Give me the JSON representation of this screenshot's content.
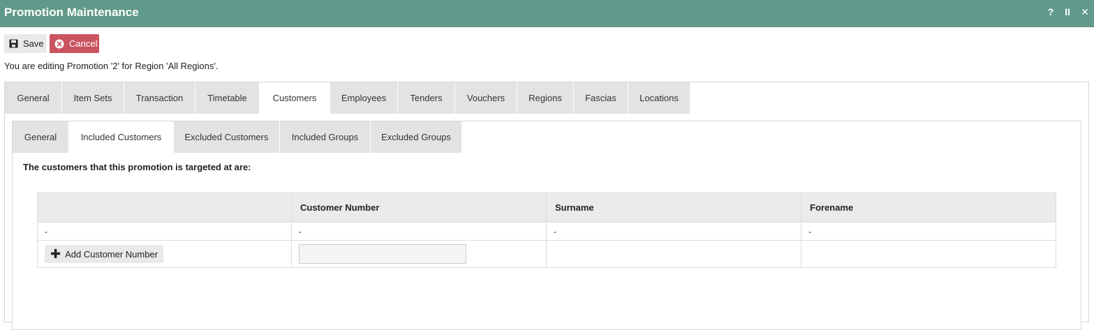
{
  "window": {
    "title": "Promotion Maintenance",
    "controls": {
      "help": "?",
      "pause": "II",
      "close": "✕"
    }
  },
  "toolbar": {
    "save_label": "Save",
    "cancel_label": "Cancel"
  },
  "info_text": "You are editing Promotion '2' for Region 'All Regions'.",
  "main_tabs": [
    {
      "label": "General",
      "active": false
    },
    {
      "label": "Item Sets",
      "active": false
    },
    {
      "label": "Transaction",
      "active": false
    },
    {
      "label": "Timetable",
      "active": false
    },
    {
      "label": "Customers",
      "active": true
    },
    {
      "label": "Employees",
      "active": false
    },
    {
      "label": "Tenders",
      "active": false
    },
    {
      "label": "Vouchers",
      "active": false
    },
    {
      "label": "Regions",
      "active": false
    },
    {
      "label": "Fascias",
      "active": false
    },
    {
      "label": "Locations",
      "active": false
    }
  ],
  "sub_tabs": [
    {
      "label": "General",
      "active": false
    },
    {
      "label": "Included Customers",
      "active": true
    },
    {
      "label": "Excluded Customers",
      "active": false
    },
    {
      "label": "Included Groups",
      "active": false
    },
    {
      "label": "Excluded Groups",
      "active": false
    }
  ],
  "section_heading": "The customers that this promotion is targeted at are:",
  "table": {
    "headers": [
      "",
      "Customer Number",
      "Surname",
      "Forename"
    ],
    "rows": [
      [
        "-",
        "-",
        "-",
        "-"
      ]
    ],
    "add_button_label": "Add Customer Number",
    "input_value": ""
  },
  "colors": {
    "titlebar": "#619a8a",
    "cancel": "#c9545f",
    "tab_inactive": "#e3e3e3"
  }
}
